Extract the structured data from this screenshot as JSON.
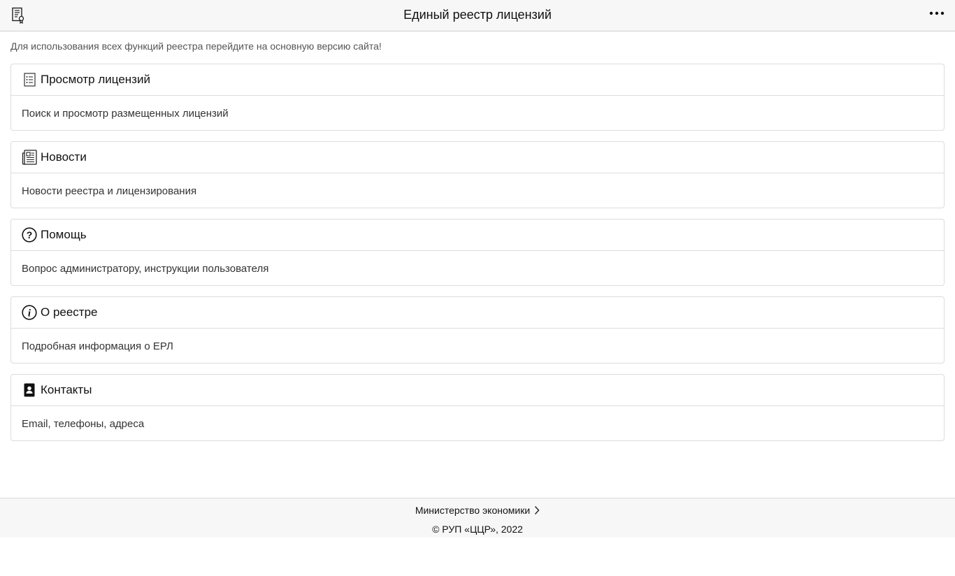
{
  "header": {
    "title": "Единый реестр лицензий",
    "logo_icon": "license-document-icon",
    "menu_icon": "more-horizontal-icon"
  },
  "notice": "Для использования всех функций реестра перейдите на основную версию сайта!",
  "cards": [
    {
      "icon": "list-icon",
      "title": "Просмотр лицензий",
      "description": "Поиск и просмотр размещенных лицензий"
    },
    {
      "icon": "newspaper-icon",
      "title": "Новости",
      "description": "Новости реестра и лицензирования"
    },
    {
      "icon": "question-circle-icon",
      "title": "Помощь",
      "description": "Вопрос администратору, инструкции пользователя"
    },
    {
      "icon": "info-circle-icon",
      "title": "О реестре",
      "description": "Подробная информация о ЕРЛ"
    },
    {
      "icon": "contact-card-icon",
      "title": "Контакты",
      "description": "Email, телефоны, адреса"
    }
  ],
  "footer": {
    "ministry_link": "Министерство экономики",
    "ministry_icon": "chevron-right-icon",
    "copyright": "© РУП «ЦЦР», 2022"
  }
}
